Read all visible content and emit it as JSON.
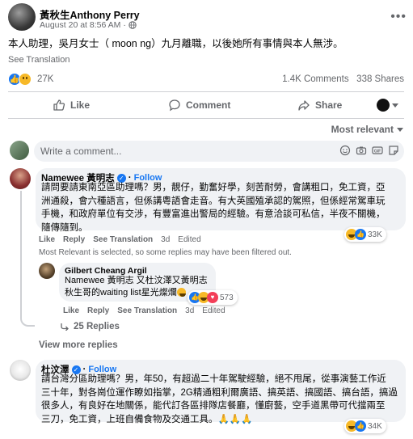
{
  "post": {
    "poster_name": "黃秋生Anthony Perry",
    "timestamp": "August 20 at 8:56 AM",
    "text": "本人助理，吳月女士（ moon ng）九月離職，以後她所有事情與本人無涉。",
    "see_translation": "See Translation",
    "reaction_count": "27K",
    "comments_count": "1.4K Comments",
    "shares_count": "338 Shares"
  },
  "actions": {
    "like": "Like",
    "comment": "Comment",
    "share": "Share"
  },
  "sort_label": "Most relevant",
  "write_comment_placeholder": "Write a comment...",
  "comments": [
    {
      "name": "Namewee 黃明志",
      "follow": "Follow",
      "text_lines": [
        "請問要請東南亞區助理嗎？男，靚仔，勤奮好學，刻苦耐勞，會講粗口，免工資，亞",
        "洲通殺，會六種語言，但係講粵語會走音。有大英國殖承認的駕照，但係經常駕車玩",
        "手機，和政府單位有交涉，有豐富進出警局的經驗。有意洽談可私信，半夜不關機，",
        "隨傳隨到。"
      ],
      "like": "Like",
      "reply": "Reply",
      "see_translation": "See Translation",
      "age": "3d",
      "edited": "Edited",
      "reaction_count": "33K"
    },
    {
      "name": "Gilbert Cheang Argil",
      "text_lines": [
        "Namewee 黃明志 又杜汶澤又黃明志",
        "秋生哥的waiting list星光燦爛"
      ],
      "like": "Like",
      "reply": "Reply",
      "see_translation": "See Translation",
      "age": "3d",
      "edited": "Edited",
      "reaction_count": "573"
    },
    {
      "name": "杜汶澤",
      "follow": "Follow",
      "text_lines": [
        "請台灣分區助理嗎？男，年50，有超過二十年駕駛經驗，絕不甩尾，從事演藝工作近",
        "三十年，對各崗位運作瞭如指掌，2G精通粗利爾廣語、搞英語、搞國語、搞台語，搞過",
        "很多人，有良好在地關係，能代訂各區排隊店餐廳，懂廚藝，空手道黑帶可代擋兩至",
        "三刀，免工資，上班自備食物及交通工具。🙏🙏🙏"
      ],
      "like": "Like",
      "reply": "Reply",
      "see_translation": "See Translation",
      "age": "3d",
      "edited": "Edited",
      "reaction_count": "34K"
    }
  ],
  "filter_note": "Most Relevant is selected, so some replies may have been filtered out.",
  "replies_link": "25 Replies",
  "view_more_replies": "View more replies",
  "colors": {
    "accent": "#1877f2",
    "secondary_text": "#65676b",
    "bubble": "#f0f2f5"
  }
}
